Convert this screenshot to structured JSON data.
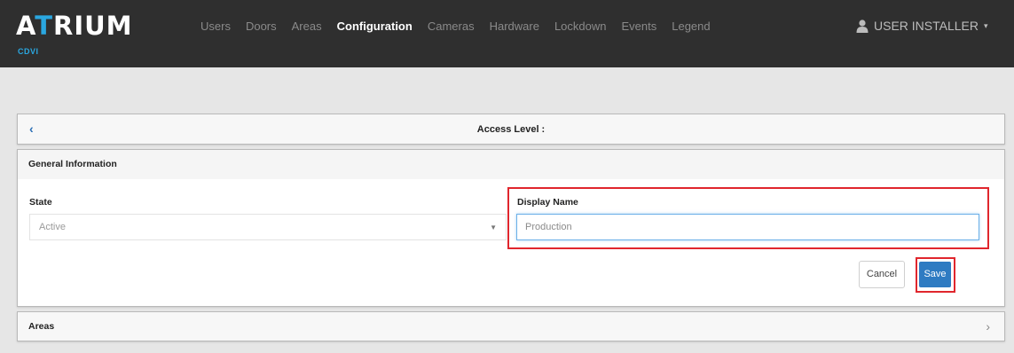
{
  "brand": {
    "logo_prefix": "A",
    "logo_accent": "T",
    "logo_rest": "RIUM",
    "sub": "CDVI"
  },
  "nav": {
    "items": [
      {
        "label": "Users"
      },
      {
        "label": "Doors"
      },
      {
        "label": "Areas"
      },
      {
        "label": "Configuration",
        "active": true
      },
      {
        "label": "Cameras"
      },
      {
        "label": "Hardware"
      },
      {
        "label": "Lockdown"
      },
      {
        "label": "Events"
      },
      {
        "label": "Legend"
      }
    ],
    "user_label": "USER INSTALLER",
    "user_icon": "user-icon",
    "user_caret": "▾"
  },
  "header_panel": {
    "back_icon": "‹",
    "title": "Access Level :"
  },
  "general": {
    "title": "General Information",
    "state_label": "State",
    "state_value": "Active",
    "state_arrow": "▼",
    "display_name_label": "Display Name",
    "display_name_value": "Production",
    "cancel_label": "Cancel",
    "save_label": "Save"
  },
  "areas": {
    "label": "Areas",
    "chevron": "›"
  },
  "colors": {
    "navbar_bg": "#2f2f2f",
    "accent": "#2aa7e0",
    "save_bg": "#2e7bc2",
    "highlight": "#e0262d"
  }
}
